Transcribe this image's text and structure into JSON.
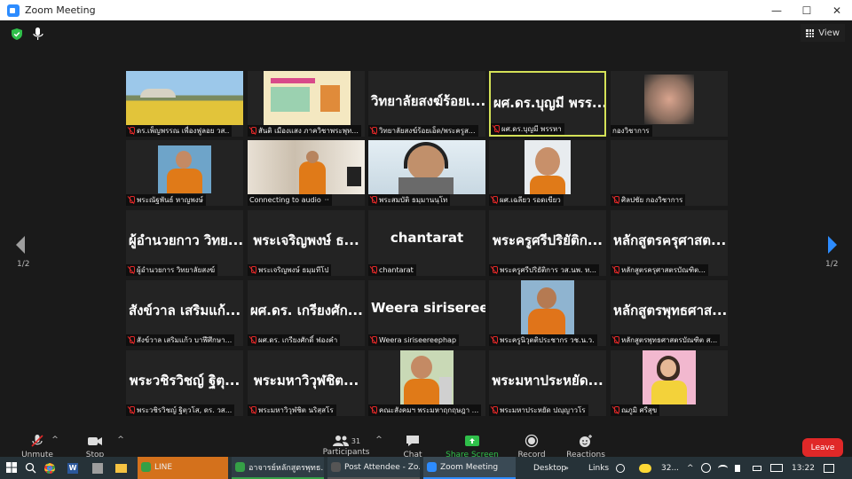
{
  "window": {
    "title": "Zoom Meeting",
    "controls": {
      "minimize": "—",
      "maximize": "☐",
      "close": "✕"
    }
  },
  "view_label": "View",
  "page": {
    "left": "1/2",
    "right": "1/2"
  },
  "tiles": [
    {
      "name": "ดร.เพ็ญพรรณ เพื่องฟูลอย วส..",
      "big": "",
      "kind": "photo-landscape",
      "muted": true
    },
    {
      "name": "สันติ เมืองแสง ภาควิชาพระพุท...",
      "big": "",
      "kind": "photo-poster",
      "muted": true
    },
    {
      "name": "วิทยาลัยสงฆ์ร้อยเอ็ด/พระครูส...",
      "big": "วิทยาลัยสงฆ์ร้อยเ...",
      "kind": "text",
      "muted": true
    },
    {
      "name": "ผศ.ดร.บุญมี พรรหา",
      "big": "ผศ.ดร.บุญมี พรร...",
      "kind": "text",
      "muted": true,
      "active": true
    },
    {
      "name": "กองวิชาการ",
      "big": "",
      "kind": "photo-blur",
      "muted": false
    },
    {
      "name": "พระณัฐพันธ์ หาญพงษ์",
      "big": "",
      "kind": "photo-monk",
      "muted": true
    },
    {
      "name": "Connecting to audio",
      "big": "",
      "kind": "photo-room",
      "muted": false,
      "connecting": true
    },
    {
      "name": "พระสมบัติ ธมฺมานนฺโท",
      "big": "",
      "kind": "photo-headset",
      "muted": true
    },
    {
      "name": "ผศ.เฉลียว รอดเขียว",
      "big": "",
      "kind": "photo-man",
      "muted": true
    },
    {
      "name": "ศิลปชัย กองวิชาการ",
      "big": "",
      "kind": "empty",
      "muted": true
    },
    {
      "name": "ผู้อำนวยการ วิทยาลัยสงฆ์",
      "big": "ผู้อำนวยกาว วิทย...",
      "kind": "text",
      "muted": true
    },
    {
      "name": "พระเจริญพงษ์ ธมฺมทีโป",
      "big": "พระเจริญพงษ์ ธ...",
      "kind": "text",
      "muted": true
    },
    {
      "name": "chantarat",
      "big": "chantarat",
      "kind": "text",
      "muted": true
    },
    {
      "name": "พระครูศรีปริยัติการ วส.นพ. ท...",
      "big": "พระครูศรีปริยัติก...",
      "kind": "text",
      "muted": true
    },
    {
      "name": "หลักสูตรครุศาสตรบัณฑิต...",
      "big": "หลักสูตรครุศาสต...",
      "kind": "text",
      "muted": true
    },
    {
      "name": "สังข์วาล เสริมแก้ว บาฬีศึกษา...",
      "big": "สังข์วาล เสริมแก้...",
      "kind": "text",
      "muted": true
    },
    {
      "name": "ผศ.ดร. เกรียงศักดิ์ ฟองคำ",
      "big": "ผศ.ดร. เกรียงศัก...",
      "kind": "text",
      "muted": true
    },
    {
      "name": "Weera siriseereephap",
      "big": "Weera siriseree...",
      "kind": "text",
      "muted": true
    },
    {
      "name": "พระครูนิวุตติประชากร วช.น.ว.",
      "big": "",
      "kind": "photo-monk2",
      "muted": true
    },
    {
      "name": "หลักสูตรพุทธศาสตรบัณฑิต ส...",
      "big": "หลักสูตรพุทธศาส...",
      "kind": "text",
      "muted": true
    },
    {
      "name": "พระวชิรวิชญ์ ฐิตฺวโส, ดร. วส...",
      "big": "พระวชิรวิชญ์ ฐิตุ...",
      "kind": "text",
      "muted": true
    },
    {
      "name": "พระมหาวิวุฬชิต นริสฺสโร",
      "big": "พระมหาวิวุฬชิต...",
      "kind": "text",
      "muted": true
    },
    {
      "name": "คณะสังคมฯ พระมหาฤกฤษฎา ...",
      "big": "",
      "kind": "photo-monk3",
      "muted": true
    },
    {
      "name": "พระมหาประหยัด ปญฺญาวโร",
      "big": "พระมหาประหยัด...",
      "kind": "text",
      "muted": true
    },
    {
      "name": "ณภูมิ ศรีสุข",
      "big": "",
      "kind": "photo-woman",
      "muted": true
    }
  ],
  "toolbar": {
    "unmute": "Unmute",
    "stop_video": "Stop Video",
    "participants": "Participants",
    "participants_count": "31",
    "chat": "Chat",
    "share_screen": "Share Screen",
    "record": "Record",
    "reactions": "Reactions",
    "leave": "Leave"
  },
  "taskbar": {
    "apps": [
      {
        "label": "LINE",
        "color": "#d4711c"
      },
      {
        "label": "อาจารย์หลักสูตรพุทธ...",
        "color": "#35a046"
      },
      {
        "label": "Post Attendee - Zo...",
        "color": "#555"
      },
      {
        "label": "Zoom Meeting",
        "color": "#2d8cff"
      }
    ],
    "desktop": "Desktop",
    "links": "Links",
    "temp": "32...",
    "time": "13:22"
  }
}
